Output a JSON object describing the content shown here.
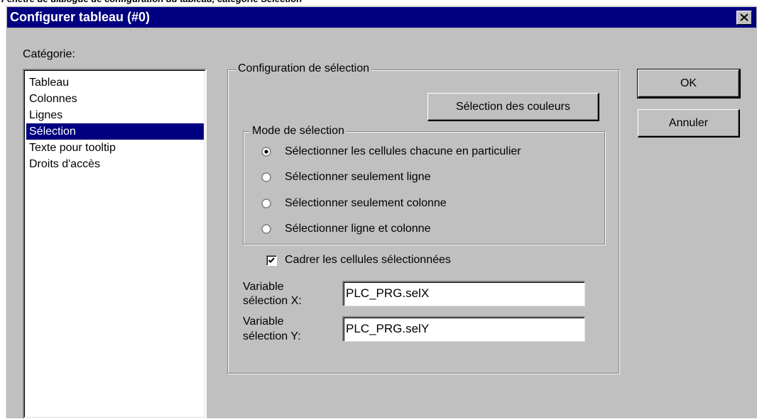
{
  "window": {
    "title": "Configurer tableau (#0)"
  },
  "category": {
    "label": "Catégorie:",
    "items": [
      {
        "label": "Tableau"
      },
      {
        "label": "Colonnes"
      },
      {
        "label": "Lignes"
      },
      {
        "label": "Sélection",
        "selected": true
      },
      {
        "label": "Texte pour tooltip"
      },
      {
        "label": "Droits d'accès"
      }
    ]
  },
  "selection_config": {
    "title": "Configuration de sélection",
    "colors_button": "Sélection des couleurs",
    "mode": {
      "title": "Mode de sélection",
      "options": [
        {
          "label": "Sélectionner les cellules chacune en particulier",
          "checked": true
        },
        {
          "label": "Sélectionner seulement ligne",
          "checked": false
        },
        {
          "label": "Sélectionner seulement colonne",
          "checked": false
        },
        {
          "label": "Sélectionner ligne et colonne",
          "checked": false
        }
      ]
    },
    "frame_cells": {
      "label": "Cadrer les cellules sélectionnées",
      "checked": true
    },
    "var_x": {
      "label_line1": "Variable",
      "label_line2": "sélection X:",
      "value": "PLC_PRG.selX"
    },
    "var_y": {
      "label_line1": "Variable",
      "label_line2": "sélection Y:",
      "value": "PLC_PRG.selY"
    }
  },
  "buttons": {
    "ok": "OK",
    "cancel": "Annuler"
  }
}
